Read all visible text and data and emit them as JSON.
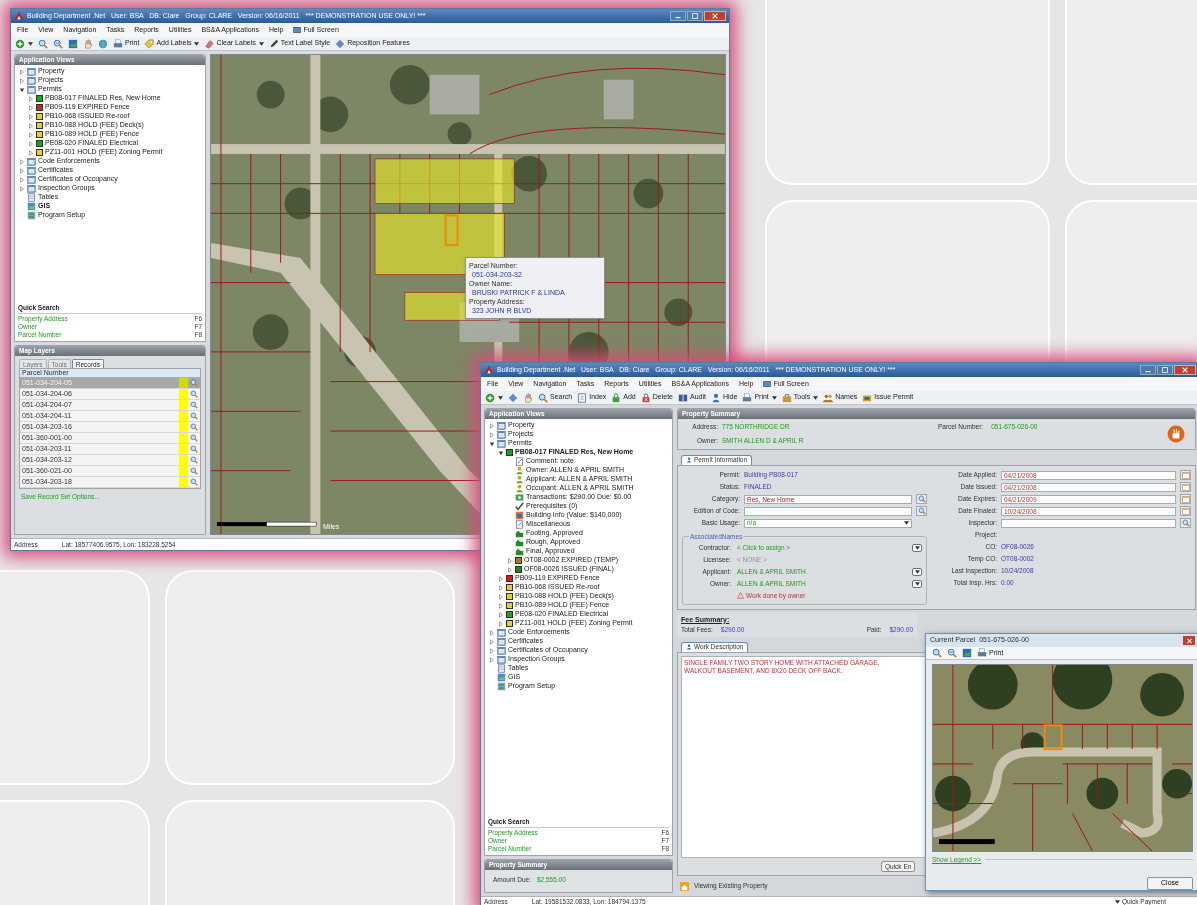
{
  "main_window": {
    "title": "Building Department .Net   User: BSA   DB: Clare   Group: CLARE   Version: 06/16/2011   *** DEMONSTRATION USE ONLY! ***",
    "menu": [
      "File",
      "View",
      "Navigation",
      "Tasks",
      "Reports",
      "Utilities",
      "BS&A Applications",
      "Help"
    ],
    "full_screen": "Full Screen",
    "toolbar": [
      {
        "kind": "plus",
        "dropdown": true
      },
      {
        "kind": "magnifier-plus",
        "dropdown": false
      },
      {
        "kind": "magnifier-minus",
        "dropdown": false
      },
      {
        "kind": "map",
        "dropdown": false
      },
      {
        "kind": "hand",
        "dropdown": false
      },
      {
        "kind": "globe",
        "dropdown": false
      },
      {
        "kind": "printer",
        "label": "Print",
        "dropdown": false
      },
      {
        "kind": "tag",
        "label": "Add Labels",
        "dropdown": true
      },
      {
        "kind": "eraser",
        "label": "Clear Labels",
        "dropdown": true
      },
      {
        "kind": "pen",
        "label": "Text Label Style",
        "dropdown": false
      },
      {
        "kind": "diamond",
        "label": "Reposition Features",
        "dropdown": false
      }
    ],
    "sidebar": {
      "title": "Application Views",
      "tree": [
        {
          "label": "Property",
          "kind": "folder",
          "expanded": false,
          "bold": false
        },
        {
          "label": "Projects",
          "kind": "folder",
          "expanded": false,
          "bold": false
        },
        {
          "label": "Permits",
          "kind": "folder",
          "expanded": true,
          "bold": false,
          "children": [
            {
              "label": "PB08-017 FINALED Res, New Home",
              "kind": "status",
              "color": "#1fa01f",
              "expanded": false,
              "bold": false
            },
            {
              "label": "PB09-119 EXPIRED Fence",
              "kind": "status",
              "color": "#d02020",
              "expanded": false,
              "bold": false
            },
            {
              "label": "PB10-068 ISSUED Re-roof",
              "kind": "status",
              "color": "#e8d020",
              "expanded": false,
              "bold": false
            },
            {
              "label": "PB10-088 HOLD (FEE) Deck(s)",
              "kind": "status",
              "color": "#e8d020",
              "expanded": false,
              "bold": false
            },
            {
              "label": "PB10-089 HOLD (FEE) Fence",
              "kind": "status",
              "color": "#e8d020",
              "expanded": false,
              "bold": false
            },
            {
              "label": "PE08-020 FINALED Electrical",
              "kind": "status",
              "color": "#1fa01f",
              "expanded": false,
              "bold": false
            },
            {
              "label": "PZ11-001 HOLD (FEE) Zoning Permit",
              "kind": "status",
              "color": "#e8d020",
              "expanded": false,
              "bold": false
            }
          ]
        },
        {
          "label": "Code Enforcements",
          "kind": "folder",
          "expanded": false,
          "bold": false
        },
        {
          "label": "Certificates",
          "kind": "folder",
          "expanded": false,
          "bold": false
        },
        {
          "label": "Certificates of Occupancy",
          "kind": "folder",
          "expanded": false,
          "bold": false
        },
        {
          "label": "Inspection Groups",
          "kind": "folder",
          "expanded": false,
          "bold": false
        },
        {
          "label": "Tables",
          "kind": "table",
          "bold": false
        },
        {
          "label": "GIS",
          "kind": "gis",
          "bold": true
        },
        {
          "label": "Program Setup",
          "kind": "setup",
          "bold": false
        }
      ],
      "quick_search": {
        "title": "Quick Search",
        "items": [
          {
            "label": "Property Address",
            "key": "F6"
          },
          {
            "label": "Owner",
            "key": "F7"
          },
          {
            "label": "Parcel Number",
            "key": "F8"
          }
        ]
      }
    },
    "map_layers": {
      "title": "Map Layers",
      "tabs": [
        {
          "label": "Layers",
          "selected": false
        },
        {
          "label": "Tools",
          "selected": false
        },
        {
          "label": "Records",
          "selected": true
        }
      ],
      "column": "Parcel Number",
      "rows": [
        {
          "parcel": "051-034-204-05",
          "selected": true
        },
        {
          "parcel": "051-034-204-06",
          "selected": false
        },
        {
          "parcel": "051-034-204-07",
          "selected": false
        },
        {
          "parcel": "051-034-204-11",
          "selected": false
        },
        {
          "parcel": "051-034-203-16",
          "selected": false
        },
        {
          "parcel": "051-360-001-00",
          "selected": false
        },
        {
          "parcel": "051-034-203-11",
          "selected": false
        },
        {
          "parcel": "051-034-203-12",
          "selected": false
        },
        {
          "parcel": "051-360-021-00",
          "selected": false
        },
        {
          "parcel": "051-034-203-18",
          "selected": false
        }
      ],
      "link": "Save Record Set Options..."
    },
    "map": {
      "popup": [
        {
          "label": "Parcel Number:",
          "value": "051-034-203-32"
        },
        {
          "label": "Owner Name:",
          "value": "BRUSKI PATRICK F & LINDA"
        },
        {
          "label": "Property Address:",
          "value": "323 JOHN R BLVD"
        }
      ],
      "scale_label": "Miles"
    },
    "status_bar": {
      "label": "Address",
      "coords": "Lat: 18577406.9575, Lon: 183228.5254"
    }
  },
  "permit_window": {
    "title": "Building Department .Net   User: BSA   DB: Clare   Group: CLARE   Version: 06/16/2011   *** DEMONSTRATION USE ONLY! ***",
    "menu": [
      "File",
      "View",
      "Navigation",
      "Tasks",
      "Reports",
      "Utilities",
      "BS&A Applications",
      "Help"
    ],
    "full_screen": "Full Screen",
    "toolbar": [
      {
        "kind": "plus",
        "dropdown": true
      },
      {
        "kind": "diamond",
        "dropdown": false
      },
      {
        "kind": "hand",
        "dropdown": false
      },
      {
        "kind": "magnifier",
        "label": "Search",
        "dropdown": false
      },
      {
        "kind": "document",
        "label": "Index",
        "dropdown": false
      },
      {
        "kind": "padlock",
        "label": "Add",
        "dropdown": false
      },
      {
        "kind": "padlock-x",
        "label": "Delete",
        "dropdown": false
      },
      {
        "kind": "book",
        "label": "Audit",
        "dropdown": false
      },
      {
        "kind": "person",
        "label": "Hide",
        "dropdown": false
      },
      {
        "kind": "printer",
        "label": "Print",
        "dropdown": true
      },
      {
        "kind": "toolbox",
        "label": "Tools",
        "dropdown": true
      },
      {
        "kind": "people",
        "label": "Names",
        "dropdown": false
      },
      {
        "kind": "stamp",
        "label": "Issue Permit",
        "dropdown": false
      }
    ],
    "sidebar": {
      "title": "Application Views",
      "tree": [
        {
          "label": "Property",
          "kind": "folder",
          "expanded": false,
          "bold": false
        },
        {
          "label": "Projects",
          "kind": "folder",
          "expanded": false,
          "bold": false
        },
        {
          "label": "Permits",
          "kind": "folder",
          "expanded": true,
          "bold": false,
          "children": [
            {
              "label": "PB08-017 FINALED Res, New Home",
              "kind": "status",
              "color": "#1fa01f",
              "expanded": true,
              "bold": true,
              "children": [
                {
                  "label": "Comment: note",
                  "kind": "note",
                  "bold": false
                },
                {
                  "label": "Owner: ALLEN & APRIL SMITH",
                  "kind": "person",
                  "bold": false
                },
                {
                  "label": "Applicant: ALLEN & APRIL SMITH",
                  "kind": "person",
                  "bold": false
                },
                {
                  "label": "Occupant: ALLEN & APRIL SMITH",
                  "kind": "person",
                  "bold": false
                },
                {
                  "label": "Transactions: $290.00 Due: $0.00",
                  "kind": "money",
                  "bold": false
                },
                {
                  "label": "Prerequisites (0)",
                  "kind": "check",
                  "bold": false
                },
                {
                  "label": "Building Info (Value: $140,000)",
                  "kind": "info",
                  "bold": false
                },
                {
                  "label": "Miscellaneous",
                  "kind": "note",
                  "bold": false
                },
                {
                  "label": "Footing, Approved",
                  "kind": "inspection",
                  "bold": false
                },
                {
                  "label": "Rough, Approved",
                  "kind": "inspection",
                  "bold": false
                },
                {
                  "label": "Final, Approved",
                  "kind": "inspection",
                  "bold": false
                },
                {
                  "label": "OT08-0002 EXPIRED (TEMP)",
                  "kind": "status",
                  "color": "#a08010",
                  "expanded": false,
                  "bold": false
                },
                {
                  "label": "OF08-0026 ISSUED (FINAL)",
                  "kind": "status",
                  "color": "#1f8a1f",
                  "expanded": false,
                  "bold": false
                }
              ]
            },
            {
              "label": "PB09-119 EXPIRED Fence",
              "kind": "status",
              "color": "#d02020",
              "expanded": false,
              "bold": false
            },
            {
              "label": "PB10-068 ISSUED Re-roof",
              "kind": "status",
              "color": "#e8d020",
              "expanded": false,
              "bold": false
            },
            {
              "label": "PB10-088 HOLD (FEE) Deck(s)",
              "kind": "status",
              "color": "#e8d020",
              "expanded": false,
              "bold": false
            },
            {
              "label": "PB10-089 HOLD (FEE) Fence",
              "kind": "status",
              "color": "#e8d020",
              "expanded": false,
              "bold": false
            },
            {
              "label": "PE08-020 FINALED Electrical",
              "kind": "status",
              "color": "#1fa01f",
              "expanded": false,
              "bold": false
            },
            {
              "label": "PZ11-001 HOLD (FEE) Zoning Permit",
              "kind": "status",
              "color": "#e8d020",
              "expanded": false,
              "bold": false
            }
          ]
        },
        {
          "label": "Code Enforcements",
          "kind": "folder",
          "expanded": false,
          "bold": false
        },
        {
          "label": "Certificates",
          "kind": "folder",
          "expanded": false,
          "bold": false
        },
        {
          "label": "Certificates of Occupancy",
          "kind": "folder",
          "expanded": false,
          "bold": false
        },
        {
          "label": "Inspection Groups",
          "kind": "folder",
          "expanded": false,
          "bold": false
        },
        {
          "label": "Tables",
          "kind": "table",
          "bold": false
        },
        {
          "label": "GIS",
          "kind": "gis",
          "bold": false
        },
        {
          "label": "Program Setup",
          "kind": "setup",
          "bold": false
        }
      ],
      "quick_search": {
        "title": "Quick Search",
        "items": [
          {
            "label": "Property Address",
            "key": "F6"
          },
          {
            "label": "Owner",
            "key": "F7"
          },
          {
            "label": "Parcel Number",
            "key": "F8"
          }
        ]
      },
      "summary": {
        "title": "Property Summary",
        "label": "Amount Due:",
        "value": "$2,555.00"
      }
    },
    "property_summary": {
      "title": "Property Summary",
      "address_label": "Address:",
      "address": "775 NORTHRIDGE DR",
      "owner_label": "Owner:",
      "owner": "SMITH ALLEN D & APRIL R",
      "parcel_label": "Parcel Number:",
      "parcel": "051-675-026-00"
    },
    "permit_tab": "Permit Information",
    "fields_left": [
      {
        "label": "Permit:",
        "value": "Building PB08-017",
        "kind": "text"
      },
      {
        "label": "Status:",
        "value": "FINALED",
        "kind": "text"
      },
      {
        "label": "Category:",
        "value": "Res, New Home",
        "kind": "lookup"
      },
      {
        "label": "Edition of Code:",
        "kind": "lookup"
      },
      {
        "label": "Basic Usage:",
        "value": "n/a",
        "kind": "select"
      }
    ],
    "fields_right": [
      {
        "label": "Date Applied:",
        "value": "04/21/2008",
        "kind": "date"
      },
      {
        "label": "Date Issued:",
        "value": "04/21/2008",
        "kind": "date"
      },
      {
        "label": "Date Expires:",
        "value": "04/21/2009",
        "kind": "date"
      },
      {
        "label": "Date Finaled:",
        "value": "10/24/2008",
        "kind": "date"
      },
      {
        "label": "Inspector:",
        "kind": "lookup"
      },
      {
        "label": "Project:",
        "kind": "text"
      },
      {
        "label": "CO:",
        "value": "OF08-0026",
        "kind": "text"
      },
      {
        "label": "Temp CO:",
        "value": "OT08-0002",
        "kind": "text"
      },
      {
        "label": "Last Inspection:",
        "value": "10/24/2008",
        "kind": "text"
      },
      {
        "label": "Total Insp. Hrs:",
        "value": "0.00",
        "kind": "text"
      }
    ],
    "associated_names": {
      "title": "AssociatedNames",
      "rows": [
        {
          "label": "Contractor:",
          "value": "< Click to assign >",
          "kind": "link",
          "menu": true
        },
        {
          "label": "Licensee:",
          "value": "< NONE >",
          "kind": "none",
          "menu": false
        },
        {
          "label": "Applicant:",
          "value": "ALLEN & APRIL SMITH",
          "kind": "link",
          "menu": true
        },
        {
          "label": "Owner:",
          "value": "ALLEN & APRIL SMITH",
          "kind": "link",
          "menu": true
        }
      ],
      "warning": "Work done by owner"
    },
    "fee_summary": {
      "title": "Fee Summary:",
      "total_label": "Total Fees:",
      "total": "$290.00",
      "paid_label": "Paid:",
      "paid": "$290.00"
    },
    "work_tab": "Work Description",
    "work_description": "SINGLE FAMILY TWO STORY HOME WITH ATTACHED GARAGE, WALKOUT BASEMENT, AND 8X20 DECK OFF BACK.",
    "quick_button": "Quick En",
    "view_status": "Viewing Existing Property",
    "status_bar": {
      "label": "Address",
      "coords": "Lat: 19581532.0833, Lon: 184794.1375",
      "quick_payment": "Quick Payment"
    }
  },
  "parcel_dialog": {
    "title": "Current Parcel",
    "parcel": "051-675-026-00",
    "toolbar": [
      {
        "kind": "magnifier-plus"
      },
      {
        "kind": "magnifier-minus"
      },
      {
        "kind": "map"
      },
      {
        "kind": "printer",
        "label": "Print"
      }
    ],
    "legend_link": "Show Legend >>",
    "close_button": "Close"
  }
}
